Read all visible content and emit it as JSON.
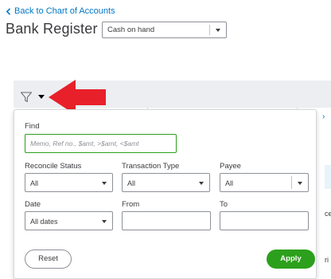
{
  "header": {
    "back_link": "Back to Chart of Accounts",
    "title": "Bank Register",
    "account_selected": "Cash on hand"
  },
  "filter_panel": {
    "find_label": "Find",
    "find_placeholder": "Memo, Ref no., $amt, >$amt, <$amt",
    "reconcile_status_label": "Reconcile Status",
    "reconcile_status_value": "All",
    "transaction_type_label": "Transaction Type",
    "transaction_type_value": "All",
    "payee_label": "Payee",
    "payee_value": "All",
    "date_label": "Date",
    "date_value": "All dates",
    "from_label": "From",
    "to_label": "To",
    "reset_label": "Reset",
    "apply_label": "Apply"
  },
  "background": {
    "edge_text_1": "ce",
    "edge_text_2": "ri"
  },
  "colors": {
    "accent_green": "#2ca01c",
    "link_blue": "#0077c5",
    "arrow_red": "#e8202a"
  }
}
